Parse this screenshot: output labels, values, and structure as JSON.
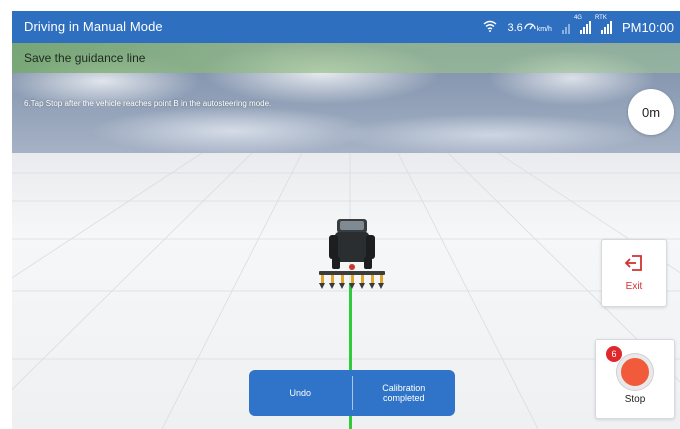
{
  "status_bar": {
    "title": "Driving in Manual Mode",
    "speed_value": "3.6",
    "speed_unit": "km/h",
    "signal_tag_1": "4G",
    "signal_tag_2": "RTK",
    "clock": "PM10:00",
    "icons": [
      "wifi-icon",
      "speedometer-icon",
      "signal-icon",
      "network-signal-icon",
      "rtk-signal-icon"
    ]
  },
  "guidance": {
    "header": "Save the guidance line",
    "instruction": "6.Tap Stop after the vehicle reaches point B in the autosteering mode.",
    "distance": "0m"
  },
  "buttons": {
    "exit_label": "Exit",
    "stop_label": "Stop",
    "stop_badge": "6"
  },
  "actions": {
    "undo_label": "Undo",
    "calibration_label_line1": "Calibration",
    "calibration_label_line2": "completed"
  },
  "colors": {
    "primary_blue": "#2e6fc0",
    "guide_line": "#2fcb3a",
    "stop_red": "#f15a3a",
    "exit_red": "#d3322f"
  }
}
